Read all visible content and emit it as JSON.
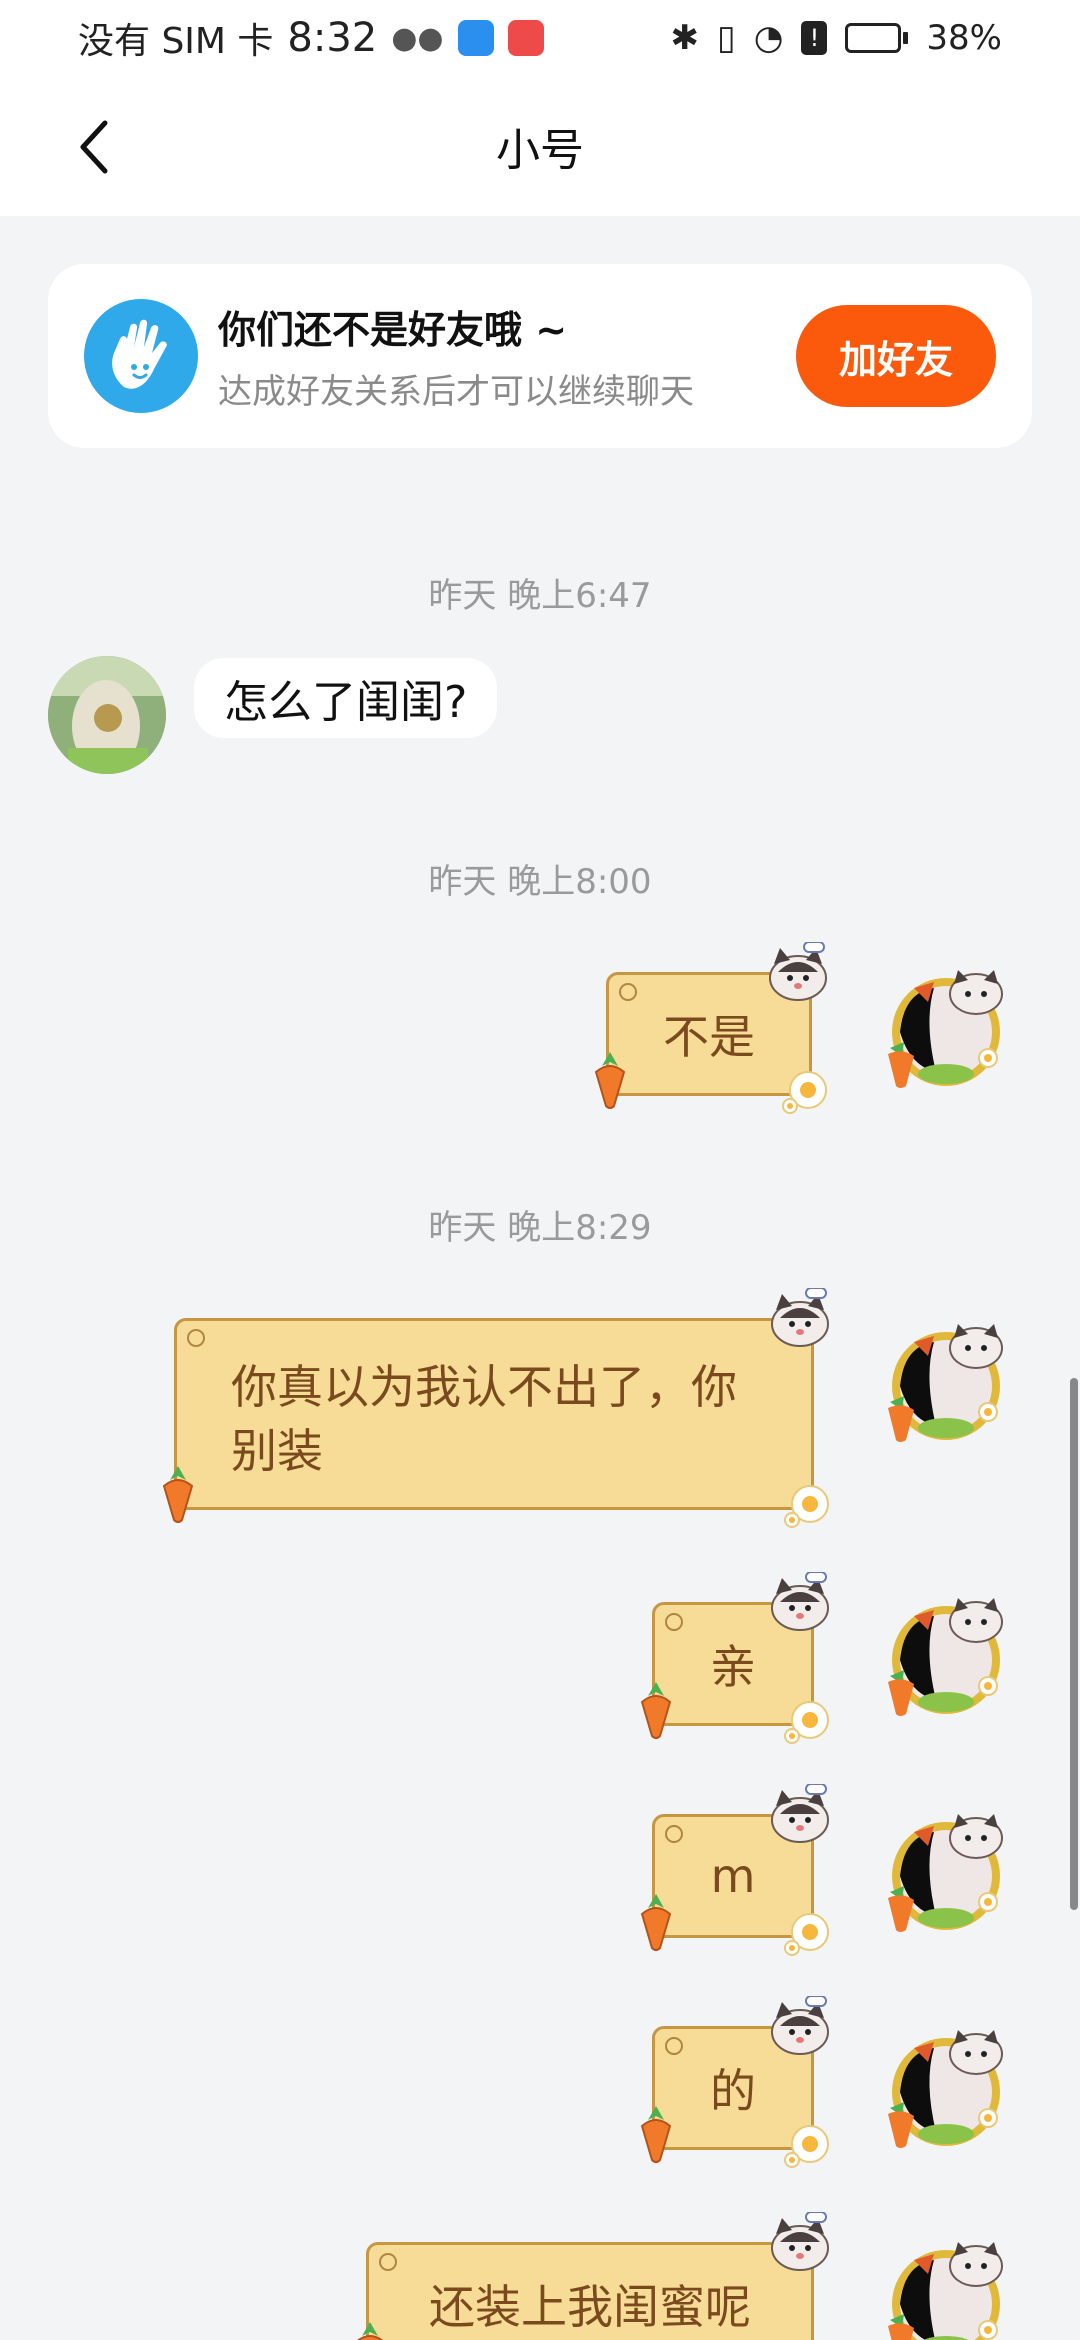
{
  "status_bar": {
    "carrier": "没有 SIM 卡",
    "time": "8:32",
    "battery": "38%",
    "battery_level": 0.38
  },
  "header": {
    "title": "小号",
    "back_icon": "chevron-left-icon"
  },
  "friend_banner": {
    "icon": "hand-wave-icon",
    "title": "你们还不是好友哦 ~",
    "subtitle": "达成好友关系后才可以继续聊天",
    "add_button": "加好友"
  },
  "messages": [
    {
      "type": "timestamp",
      "text": "昨天 晚上6:47"
    },
    {
      "type": "received",
      "text": "怎么了闺闺?"
    },
    {
      "type": "timestamp",
      "text": "昨天 晚上8:00"
    },
    {
      "type": "sent",
      "text": "不是"
    },
    {
      "type": "timestamp",
      "text": "昨天 晚上8:29"
    },
    {
      "type": "sent",
      "lines": [
        "你真以为我认不出了，你",
        "别装"
      ]
    },
    {
      "type": "sent",
      "text": "亲"
    },
    {
      "type": "sent",
      "text": "m"
    },
    {
      "type": "sent",
      "text": "的"
    },
    {
      "type": "sent",
      "text": "还装上我闺蜜呢"
    }
  ],
  "colors": {
    "accent": "#fb5a0c",
    "bubble_out": "#f6dc96",
    "bubble_out_border": "#c69643",
    "bubble_out_text": "#7a4a1e",
    "background": "#f3f4f6"
  }
}
